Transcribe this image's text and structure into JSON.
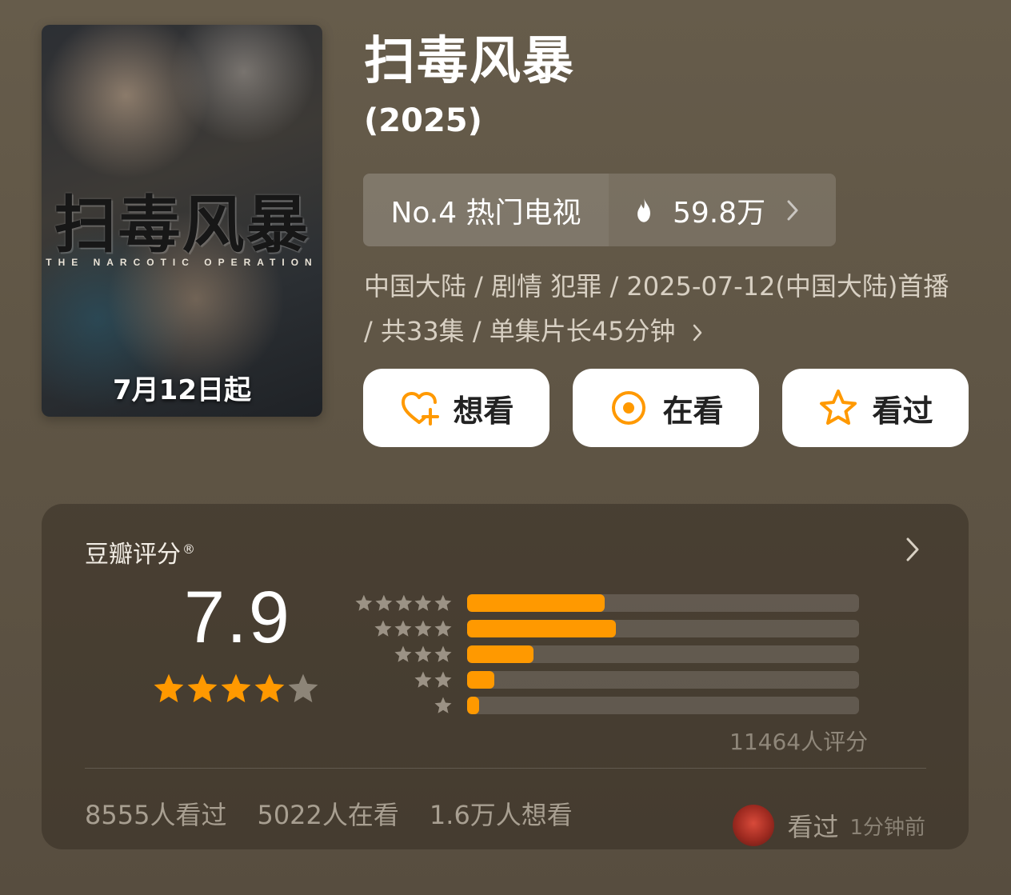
{
  "show": {
    "title": "扫毒风暴",
    "year": "(2025)",
    "poster": {
      "title_art": "扫毒风暴",
      "subtitle_art": "THE NARCOTIC OPERATION",
      "date_text": "7月12日起"
    },
    "rank": {
      "label": "No.4 热门电视",
      "heat": "59.8万"
    },
    "meta_line": "中国大陆 / 剧情 犯罪 / 2025-07-12(中国大陆)首播 / 共33集 / 单集片长45分钟"
  },
  "actions": {
    "want": "想看",
    "watching": "在看",
    "watched": "看过"
  },
  "rating": {
    "label": "豆瓣评分",
    "registered_mark": "®",
    "score": "7.9",
    "stars_filled": 4,
    "stars_total": 5,
    "distribution": [
      {
        "stars": 5,
        "fraction": 0.35
      },
      {
        "stars": 4,
        "fraction": 0.38
      },
      {
        "stars": 3,
        "fraction": 0.17
      },
      {
        "stars": 2,
        "fraction": 0.07
      },
      {
        "stars": 1,
        "fraction": 0.03
      }
    ],
    "raters": "11464人评分",
    "stats": {
      "watched": "8555人看过",
      "watching": "5022人在看",
      "want": "1.6万人想看"
    },
    "activity": {
      "action": "看过",
      "time": "1分钟前"
    }
  },
  "colors": {
    "accent": "#ff9900",
    "background": "#615747"
  },
  "icons": {
    "heat": "flame-icon",
    "want": "heart-plus-icon",
    "watching": "target-icon",
    "watched": "star-outline-icon"
  }
}
